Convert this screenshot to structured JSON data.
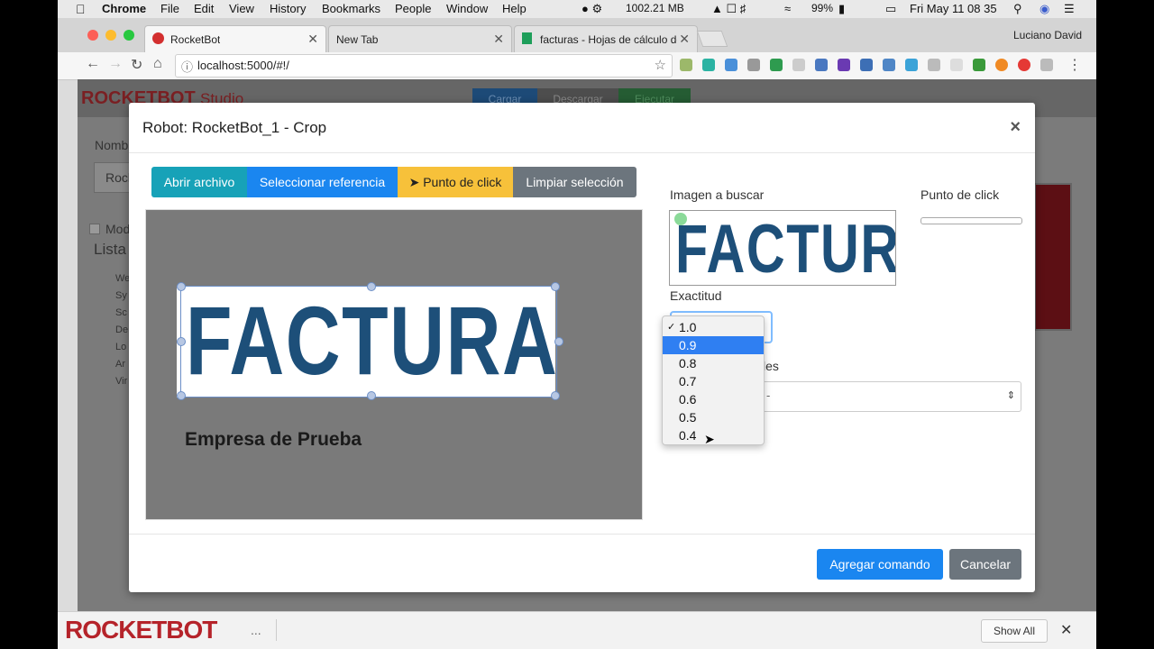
{
  "menubar": {
    "app": "Chrome",
    "items": [
      "File",
      "Edit",
      "View",
      "History",
      "Bookmarks",
      "People",
      "Window",
      "Help"
    ],
    "memory": "1002.21 MB",
    "battery": "99%",
    "datetime": "Fri May 11  08 35"
  },
  "browser": {
    "profile": "Luciano David",
    "tabs": [
      {
        "label": "RocketBot",
        "active": true
      },
      {
        "label": "New Tab",
        "active": false
      },
      {
        "label": "facturas - Hojas de cálculo de",
        "active": false
      }
    ],
    "url": "localhost:5000/#!/"
  },
  "app": {
    "logo": "ROCKETBOT",
    "logo_sub": "Studio",
    "toolbar": [
      "Cargar",
      "Descargar",
      "Ejecutar"
    ],
    "side_labels": {
      "nombre": "Nomb",
      "rock": "Rock",
      "modo": "Mod",
      "lista": "Lista"
    },
    "side_items": [
      "We",
      "Sy",
      "Sc",
      "De",
      "Lo",
      "Ar",
      "Vir"
    ]
  },
  "modal": {
    "title": "Robot: RocketBot_1 - Crop",
    "buttons": {
      "open_file": "Abrir archivo",
      "select_reference": "Seleccionar referencia",
      "click_point": "Punto de click",
      "clear_selection": "Limpiar selección"
    },
    "image_text": "FACTURA",
    "image_subtext": "Empresa de Prueba",
    "search_image_label": "Imagen a buscar",
    "click_point_label": "Punto de click",
    "accuracy_label": "Exactitud",
    "accuracy_options": [
      "1.0",
      "0.9",
      "0.8",
      "0.7",
      "0.6",
      "0.5",
      "0.4"
    ],
    "accuracy_selected": "1.0",
    "accuracy_highlighted": "0.9",
    "partial_label": "les",
    "partial_select": "-",
    "add_command": "Agregar comando",
    "cancel": "Cancelar"
  },
  "bottom_bar": {
    "show_all": "Show All",
    "download_dots": "..."
  }
}
